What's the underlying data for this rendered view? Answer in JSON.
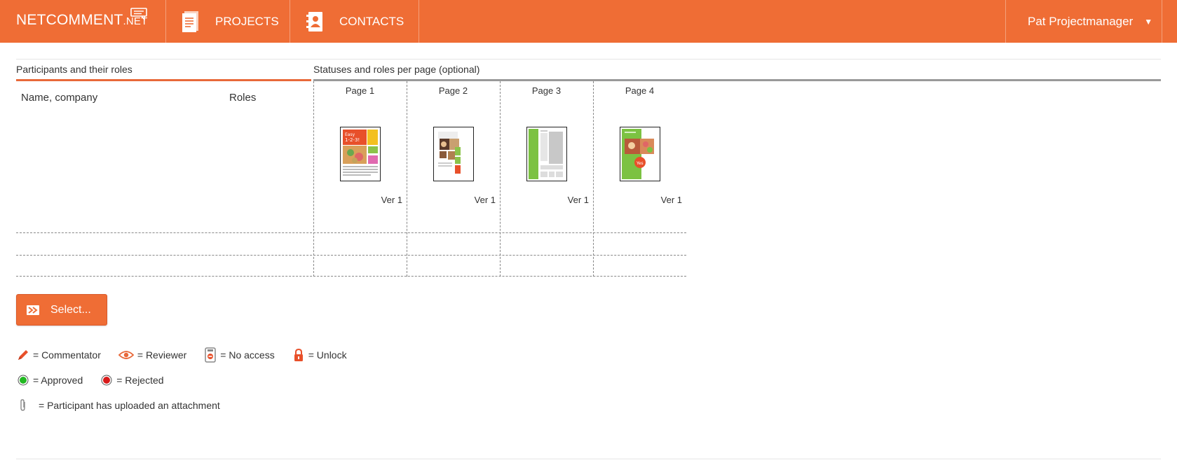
{
  "header": {
    "logo_main": "NETCOMMENT",
    "logo_suffix": ".NET",
    "nav": [
      {
        "label": "PROJECTS",
        "icon": "document-icon"
      },
      {
        "label": "CONTACTS",
        "icon": "address-book-icon"
      }
    ],
    "user": "Pat Projectmanager",
    "colors": {
      "brand": "#ef6d35"
    }
  },
  "participants": {
    "title": "Participants and their roles",
    "col_name": "Name, company",
    "col_roles": "Roles"
  },
  "statuses": {
    "title": "Statuses and roles per page (optional)"
  },
  "pages": [
    {
      "label": "Page 1",
      "version": "Ver 1"
    },
    {
      "label": "Page 2",
      "version": "Ver 1"
    },
    {
      "label": "Page 3",
      "version": "Ver 1"
    },
    {
      "label": "Page 4",
      "version": "Ver 1"
    }
  ],
  "select_button": "Select...",
  "legend": {
    "row1": [
      {
        "icon": "pencil-icon",
        "label": "= Commentator"
      },
      {
        "icon": "eye-icon",
        "label": "= Reviewer"
      },
      {
        "icon": "no-access-icon",
        "label": "= No access"
      },
      {
        "icon": "lock-icon",
        "label": "= Unlock"
      }
    ],
    "row2": [
      {
        "icon": "green-dot-icon",
        "label": "= Approved"
      },
      {
        "icon": "red-dot-icon",
        "label": "= Rejected"
      }
    ],
    "row3": [
      {
        "icon": "paperclip-icon",
        "label": "= Participant has uploaded an attachment"
      }
    ]
  }
}
